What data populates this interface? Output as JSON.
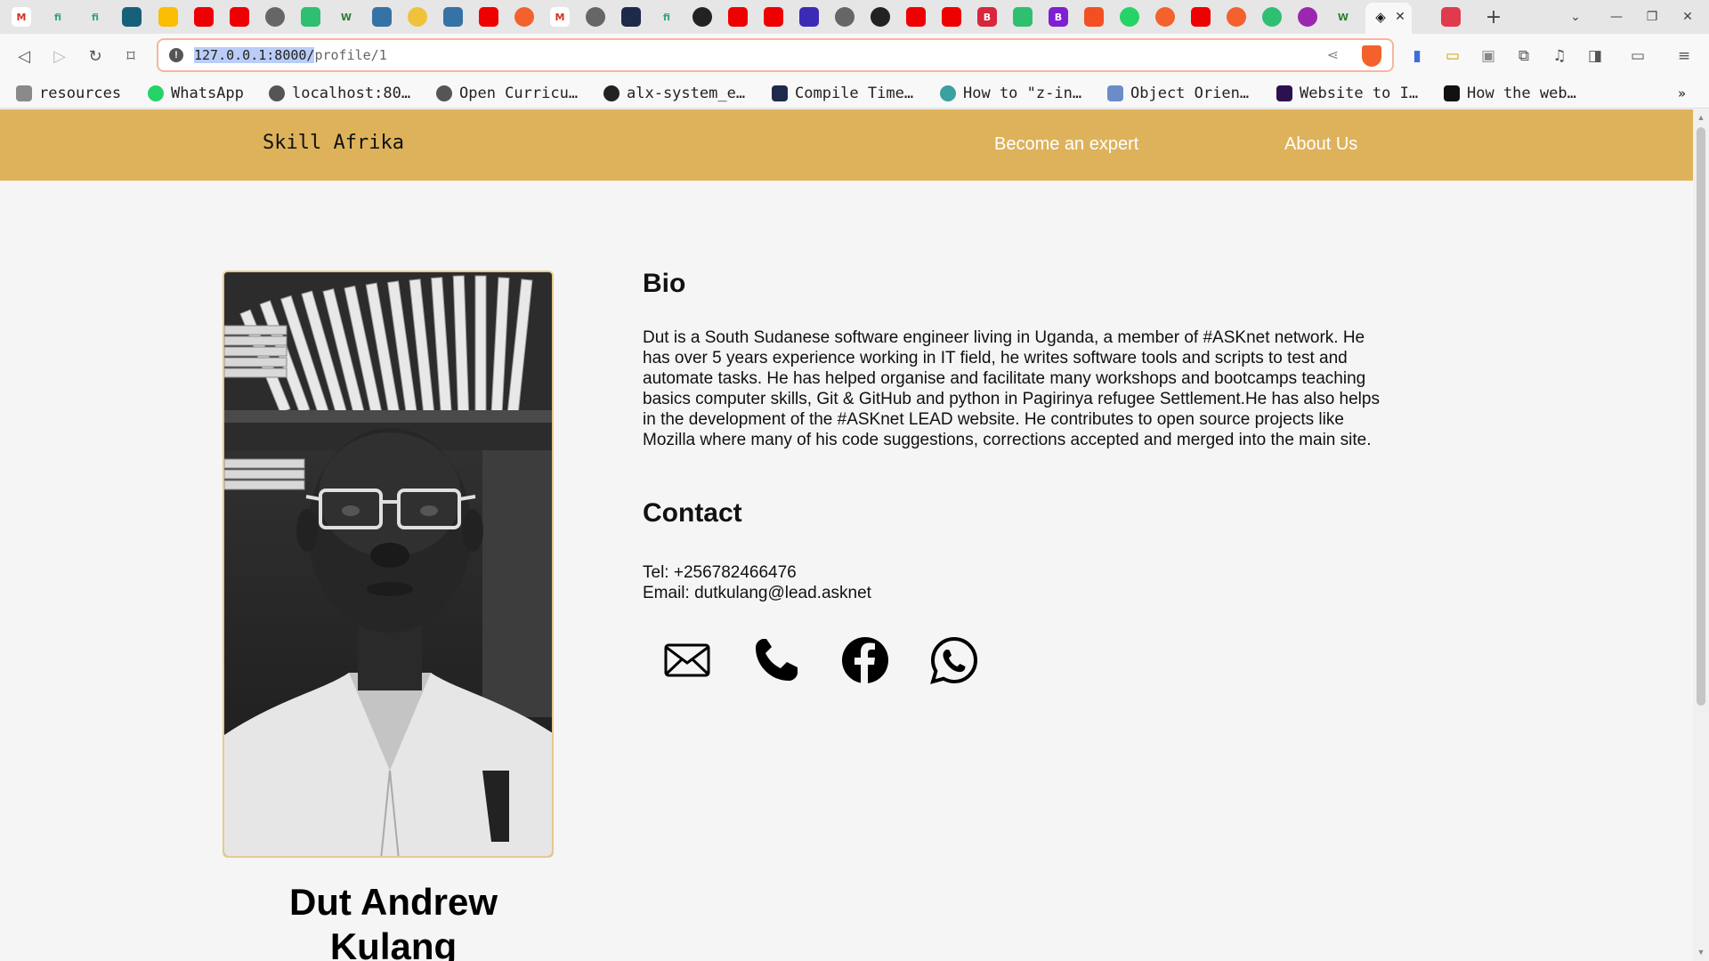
{
  "browser": {
    "url_host": "127.0.0.1:8000/",
    "url_path": "profile/1",
    "bookmarks": [
      {
        "label": "resources",
        "color": "#8a8a8a"
      },
      {
        "label": "WhatsApp",
        "color": "#25d366"
      },
      {
        "label": "localhost:80…",
        "color": "#555555"
      },
      {
        "label": "Open Curricu…",
        "color": "#555555"
      },
      {
        "label": "alx-system_e…",
        "color": "#222222"
      },
      {
        "label": "Compile Time…",
        "color": "#1e2a4a"
      },
      {
        "label": "How to \"z-in…",
        "color": "#3aa0a0"
      },
      {
        "label": "Object Orien…",
        "color": "#6b8cc7"
      },
      {
        "label": "Website to I…",
        "color": "#2b1150"
      },
      {
        "label": "How the web…",
        "color": "#111111"
      }
    ]
  },
  "site": {
    "brand": "Skill Afrika",
    "nav": [
      "Become an expert",
      "About Us"
    ]
  },
  "profile": {
    "name": "Dut Andrew Kulang",
    "bio_heading": "Bio",
    "bio": "Dut is a South Sudanese software engineer living in Uganda, a member of #ASKnet network. He has over 5 years experience working in IT field, he writes software tools and scripts to test and automate tasks. He has helped organise and facilitate many workshops and bootcamps teaching basics computer skills, Git & GitHub and python in Pagirinya refugee Settlement.He has also helps in the development of the #ASKnet LEAD website. He contributes to open source projects like Mozilla where many of his code suggestions, corrections accepted and merged into the main site.",
    "contact_heading": "Contact",
    "tel": "Tel: +256782466476",
    "email": "Email: dutkulang@lead.asknet",
    "social_icons": [
      "envelope-icon",
      "phone-icon",
      "facebook-icon",
      "whatsapp-icon"
    ]
  },
  "colors": {
    "header_bg": "#deb25b",
    "page_bg": "#f5f5f5",
    "url_border": "#f5b6a2"
  }
}
